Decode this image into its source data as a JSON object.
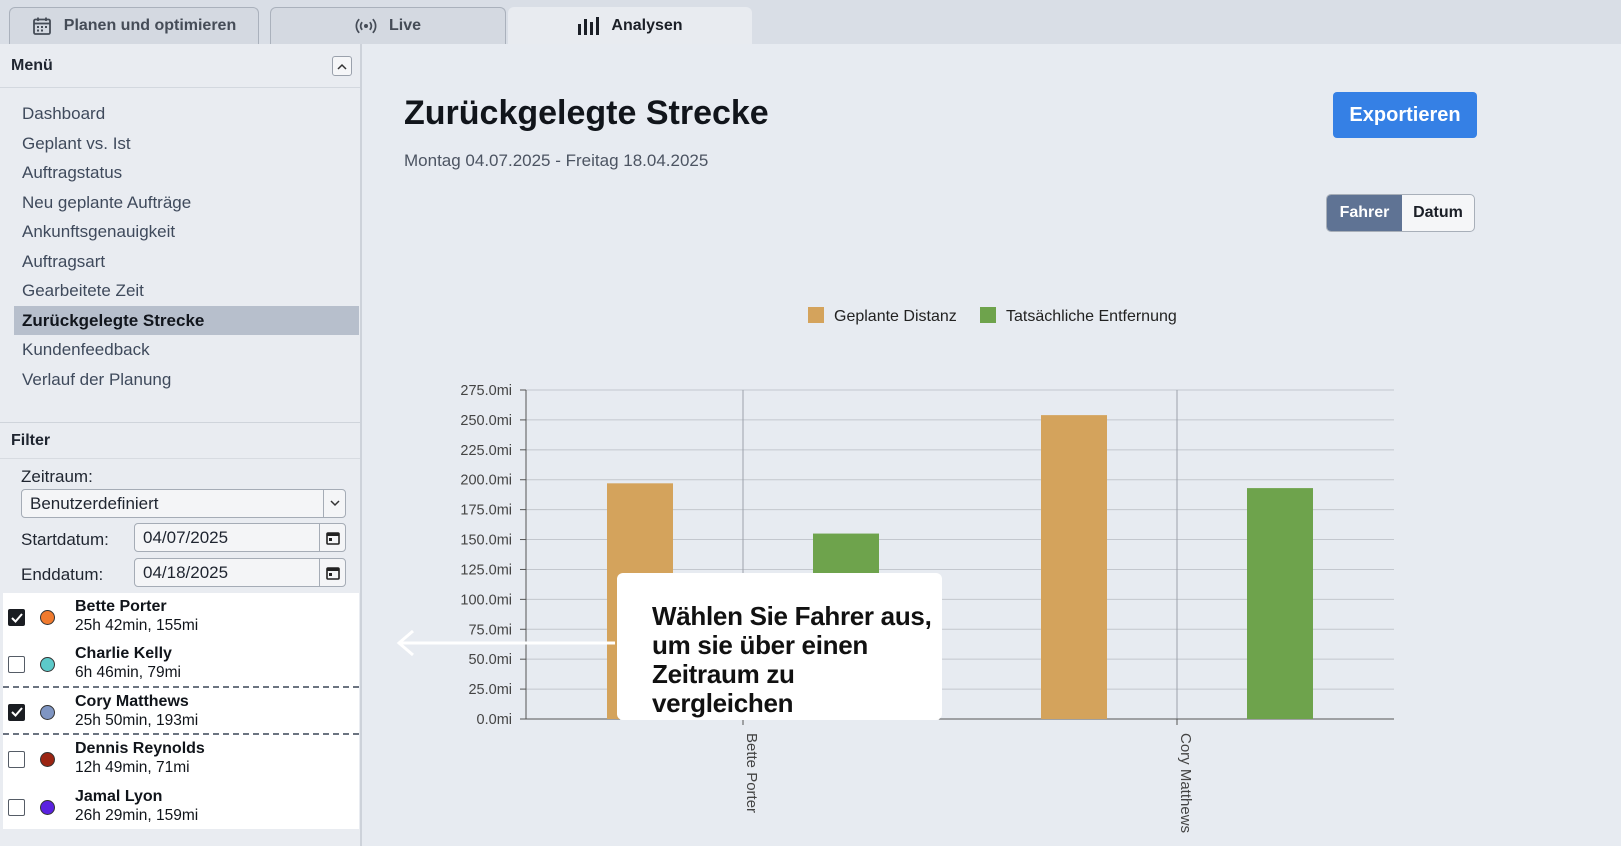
{
  "tabs": [
    {
      "label": "Planen und optimieren",
      "icon": "calendar-icon"
    },
    {
      "label": "Live",
      "icon": "broadcast-icon"
    },
    {
      "label": "Analysen",
      "icon": "bar-chart-icon",
      "active": true
    }
  ],
  "sidebar": {
    "menu_title": "Menü",
    "menu_items": [
      {
        "label": "Dashboard"
      },
      {
        "label": "Geplant vs. Ist"
      },
      {
        "label": "Auftragstatus"
      },
      {
        "label": "Neu geplante Aufträge"
      },
      {
        "label": "Ankunftsgenauigkeit"
      },
      {
        "label": "Auftragsart"
      },
      {
        "label": "Gearbeitete Zeit"
      },
      {
        "label": "Zurückgelegte Strecke",
        "active": true
      },
      {
        "label": "Kundenfeedback"
      },
      {
        "label": "Verlauf der Planung"
      }
    ],
    "filter": {
      "title": "Filter",
      "period_label": "Zeitraum:",
      "period_value": "Benutzerdefiniert",
      "start_label": "Startdatum:",
      "start_value": "04/07/2025",
      "end_label": "Enddatum:",
      "end_value": "04/18/2025"
    },
    "drivers": [
      {
        "name": "Bette Porter",
        "stats": "25h 42min, 155mi",
        "checked": true,
        "color": "#f07a2e"
      },
      {
        "name": "Charlie Kelly",
        "stats": "6h 46min, 79mi",
        "checked": false,
        "color": "#5cc9c9"
      },
      {
        "name": "Cory Matthews",
        "stats": "25h 50min, 193mi",
        "checked": true,
        "color": "#7f95c2"
      },
      {
        "name": "Dennis Reynolds",
        "stats": "12h 49min, 71mi",
        "checked": false,
        "color": "#9b2412"
      },
      {
        "name": "Jamal Lyon",
        "stats": "26h 29min, 159mi",
        "checked": false,
        "color": "#5a22e0"
      }
    ]
  },
  "main": {
    "title": "Zurückgelegte Strecke",
    "subtitle": "Montag 04.07.2025 - Freitag 18.04.2025",
    "export_label": "Exportieren",
    "toggle": {
      "driver_label": "Fahrer",
      "date_label": "Datum"
    },
    "callout": "Wählen Sie Fahrer aus, um sie über einen Zeitraum zu vergleichen"
  },
  "chart_data": {
    "type": "bar",
    "categories": [
      "Bette Porter",
      "Cory Matthews"
    ],
    "series": [
      {
        "name": "Geplante Distanz",
        "color": "#d4a35c",
        "values": [
          197,
          254
        ]
      },
      {
        "name": "Tatsächliche Entfernung",
        "color": "#6ea34c",
        "values": [
          155,
          193
        ]
      }
    ],
    "yticks": [
      "0.0mi",
      "25.0mi",
      "50.0mi",
      "75.0mi",
      "100.0mi",
      "125.0mi",
      "150.0mi",
      "175.0mi",
      "200.0mi",
      "225.0mi",
      "250.0mi",
      "275.0mi"
    ],
    "ylim": [
      0,
      275
    ],
    "legend_position": "top",
    "grid": true
  }
}
